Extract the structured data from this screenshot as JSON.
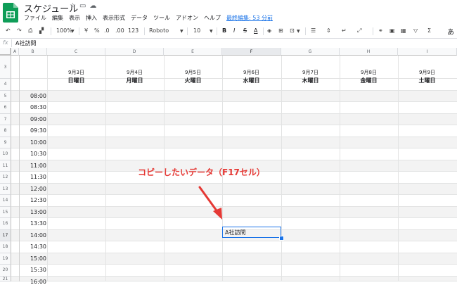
{
  "app": {
    "doc_title": "スケジュール",
    "title_icons": [
      "star-icon",
      "folder-icon",
      "cloud-icon"
    ],
    "menu": [
      "ファイル",
      "編集",
      "表示",
      "挿入",
      "表示形式",
      "データ",
      "ツール",
      "アドオン",
      "ヘルプ"
    ],
    "last_edit": "最終編集: 53 分前",
    "brand_color": "#0f9d58",
    "accent_color": "#1a73e8"
  },
  "toolbar": {
    "undo": "↶",
    "redo": "↷",
    "print": "⎙",
    "paint_format": "🖌",
    "zoom": "100%",
    "currency": "¥",
    "percent": "%",
    "decimal_decrease": ".0",
    "decimal_increase": ".00",
    "format_more": "123",
    "font": "Roboto",
    "font_size": "10",
    "bold": "B",
    "italic": "I",
    "strikethrough": "S",
    "text_color": "A",
    "more": "あ"
  },
  "formula_bar": {
    "fx": "fx",
    "value": "A社訪問"
  },
  "columns": [
    "A",
    "B",
    "C",
    "D",
    "E",
    "F",
    "G",
    "H",
    "I"
  ],
  "selected_column": "F",
  "rows": [
    "3",
    "4",
    "5",
    "6",
    "7",
    "8",
    "9",
    "10",
    "11",
    "12",
    "13",
    "14",
    "15",
    "16",
    "17",
    "18",
    "19",
    "20",
    "21"
  ],
  "selected_row": "17",
  "days": [
    {
      "date": "9月3日",
      "day": "日曜日"
    },
    {
      "date": "9月4日",
      "day": "月曜日"
    },
    {
      "date": "9月5日",
      "day": "火曜日"
    },
    {
      "date": "9月6日",
      "day": "水曜日"
    },
    {
      "date": "9月7日",
      "day": "木曜日"
    },
    {
      "date": "9月8日",
      "day": "金曜日"
    },
    {
      "date": "9月9日",
      "day": "土曜日"
    }
  ],
  "times": [
    "08:00",
    "08:30",
    "09:00",
    "09:30",
    "10:00",
    "10:30",
    "11:00",
    "11:30",
    "12:00",
    "12:30",
    "13:00",
    "13:30",
    "14:00",
    "14:30",
    "15:00",
    "15:30",
    "16:00"
  ],
  "selected_cell": {
    "ref": "F17",
    "value": "A社訪問"
  },
  "annotation": {
    "text": "コピーしたいデータ（F17セル）",
    "color": "#e53935"
  }
}
